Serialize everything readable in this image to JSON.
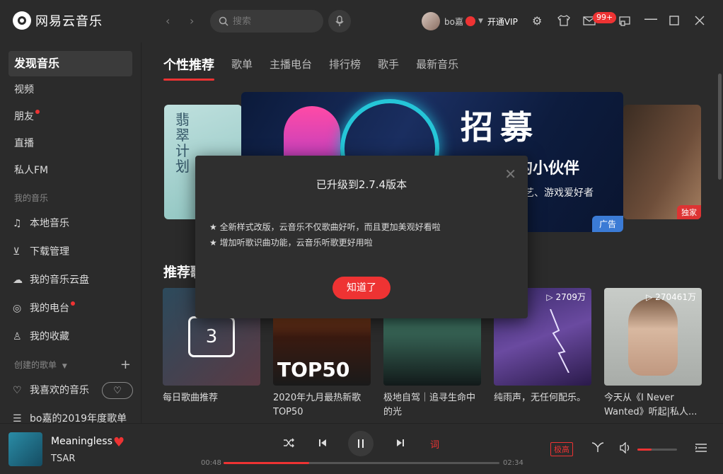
{
  "app": {
    "name": "网易云音乐",
    "search_placeholder": "搜索",
    "username": "bo嘉",
    "vip_label": "开通VIP",
    "msg_count": "99+"
  },
  "sidebar": {
    "active": "发现音乐",
    "items": [
      "视频",
      "朋友",
      "直播",
      "私人FM"
    ],
    "my_music_label": "我的音乐",
    "my_music": [
      "本地音乐",
      "下载管理",
      "我的音乐云盘",
      "我的电台",
      "我的收藏"
    ],
    "created_label": "创建的歌单",
    "playlists": [
      "我喜欢的音乐",
      "bo嘉的2019年度歌单"
    ]
  },
  "tabs": [
    "个性推荐",
    "歌单",
    "主播电台",
    "排行榜",
    "歌手",
    "最新音乐"
  ],
  "banner": {
    "title": "招募",
    "subtitle": "的小伙伴",
    "subtitle2": "艺、游戏爱好者",
    "tag": "广告",
    "side_tag": "独家",
    "left_text": "翡翠计划"
  },
  "section_title": "推荐歌单",
  "cards": [
    {
      "title": "每日歌曲推荐",
      "count": "",
      "day": "3"
    },
    {
      "title": "2020年九月最热新歌TOP50",
      "count": "",
      "cover_text": "TOP50"
    },
    {
      "title": "极地自驾｜追寻生命中的光",
      "count": ""
    },
    {
      "title": "纯雨声，无任何配乐。",
      "count": "▷ 2709万"
    },
    {
      "title": "今天从《I Never Wanted》听起|私人...",
      "count": "▷ 270461万"
    }
  ],
  "dialog": {
    "title": "已升级到2.7.4版本",
    "lines": [
      "★ 全新样式改版，云音乐不仅歌曲好听，而且更加美观好看啦",
      "★ 增加听歌识曲功能，云音乐听歌更好用啦"
    ],
    "button": "知道了"
  },
  "player": {
    "song": "Meaningless",
    "artist": "TSAR",
    "current": "00:48",
    "total": "02:34",
    "progress": 0.31,
    "quality": "极高",
    "volume": 0.35,
    "lyric_icon": "词"
  }
}
